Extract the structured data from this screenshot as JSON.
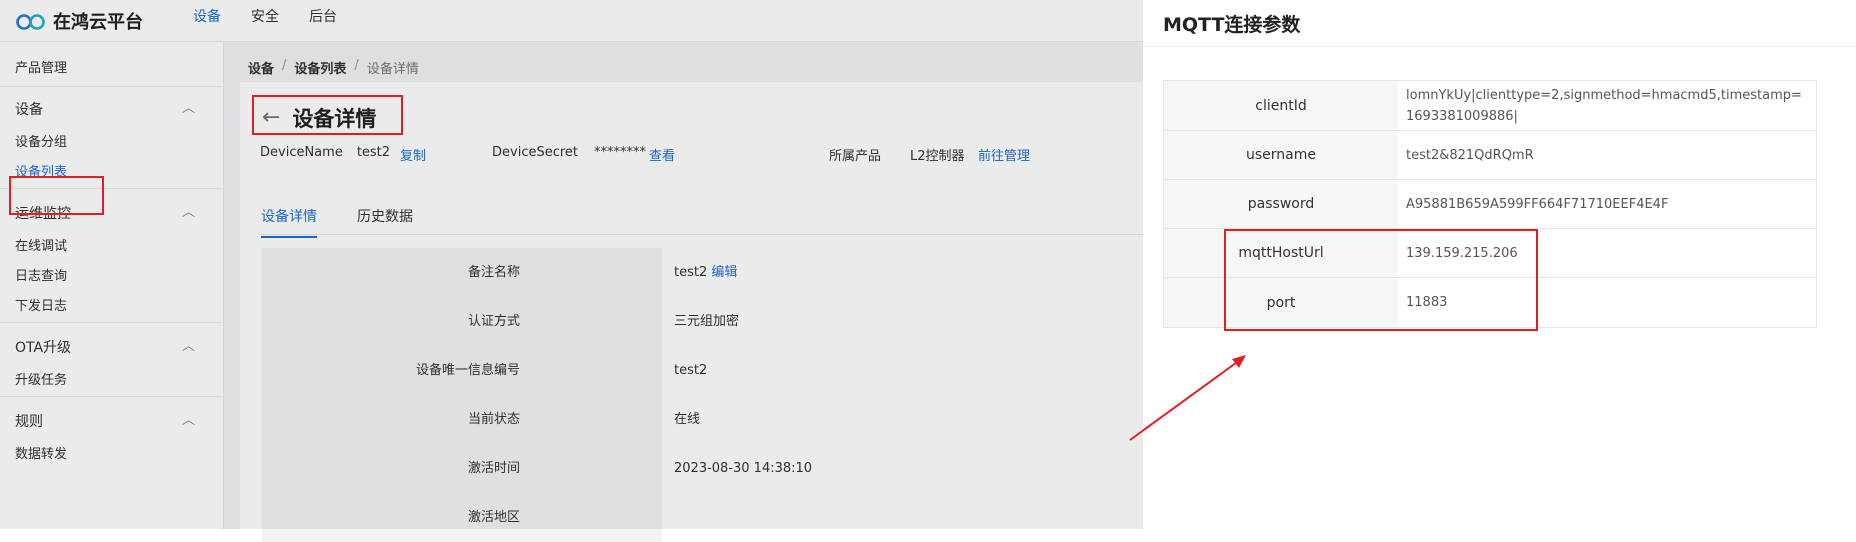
{
  "app": {
    "name": "在鸿云平台"
  },
  "topnav": [
    "设备",
    "安全",
    "后台"
  ],
  "sidebar": {
    "product": "产品管理",
    "device_group": "设备",
    "device_items": [
      "设备分组",
      "设备列表"
    ],
    "ops_group": "运维监控",
    "ops_items": [
      "在线调试",
      "日志查询",
      "下发日志"
    ],
    "ota_group": "OTA升级",
    "ota_items": [
      "升级任务"
    ],
    "rules_group": "规则",
    "rules_items": [
      "数据转发"
    ]
  },
  "breadcrumb": [
    "设备",
    "设备列表",
    "设备详情"
  ],
  "page": {
    "title": "设备详情",
    "device_name_label": "DeviceName",
    "device_name": "test2",
    "copy": "复制",
    "device_secret_label": "DeviceSecret",
    "device_secret": "********",
    "view": "查看",
    "product_label": "所属产品",
    "product": "L2控制器",
    "manage": "前往管理"
  },
  "tabs": [
    "设备详情",
    "历史数据"
  ],
  "details": [
    {
      "label": "备注名称",
      "value": "test2",
      "action": "编辑"
    },
    {
      "label": "认证方式",
      "value": "三元组加密"
    },
    {
      "label": "设备唯一信息编号",
      "value": "test2"
    },
    {
      "label": "当前状态",
      "value": "在线"
    },
    {
      "label": "激活时间",
      "value": "2023-08-30 14:38:10"
    },
    {
      "label": "激活地区",
      "value": ""
    }
  ],
  "drawer": {
    "title": "MQTT连接参数",
    "rows": [
      {
        "label": "clientId",
        "value": "lomnYkUy|clienttype=2,signmethod=hmacmd5,timestamp=1693381009886|"
      },
      {
        "label": "username",
        "value": "test2&821QdRQmR"
      },
      {
        "label": "password",
        "value": "A95881B659A599FF664F71710EEF4E4F"
      },
      {
        "label": "mqttHostUrl",
        "value": "139.159.215.206"
      },
      {
        "label": "port",
        "value": "11883"
      }
    ]
  },
  "colors": {
    "accent": "#1e6fd9",
    "annotation": "#e02020"
  }
}
